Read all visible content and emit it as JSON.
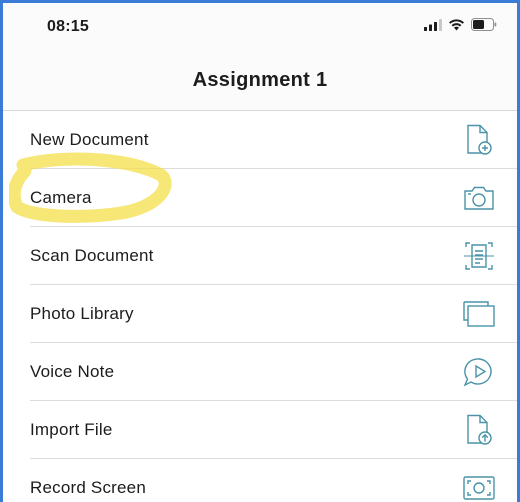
{
  "status_bar": {
    "time": "08:15",
    "icons": [
      "signal-icon",
      "wifi-icon",
      "battery-icon"
    ]
  },
  "header": {
    "title": "Assignment 1"
  },
  "menu": {
    "items": [
      {
        "label": "New Document",
        "icon": "new-document-icon"
      },
      {
        "label": "Camera",
        "icon": "camera-icon"
      },
      {
        "label": "Scan Document",
        "icon": "scan-document-icon"
      },
      {
        "label": "Photo Library",
        "icon": "photo-library-icon"
      },
      {
        "label": "Voice Note",
        "icon": "voice-note-icon"
      },
      {
        "label": "Import File",
        "icon": "import-file-icon"
      },
      {
        "label": "Record Screen",
        "icon": "record-screen-icon"
      }
    ]
  },
  "colors": {
    "icon_tint": "#4a93a8",
    "highlight": "#f3df4a",
    "frame_border": "#3a7bd5"
  }
}
